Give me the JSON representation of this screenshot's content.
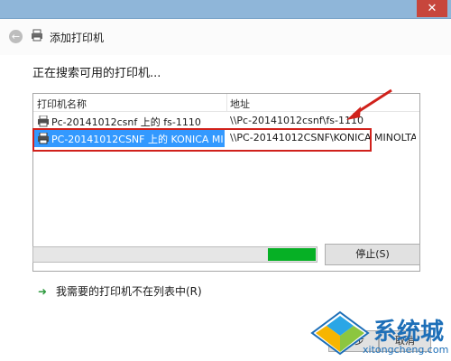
{
  "window": {
    "close_glyph": "✕"
  },
  "nav": {
    "back_glyph": "←",
    "title": "添加打印机",
    "printer_icon": "printer-icon"
  },
  "content": {
    "heading": "正在搜索可用的打印机...",
    "columns": [
      "打印机名称",
      "地址"
    ],
    "rows": [
      {
        "name": "Pc-20141012csnf 上的 fs-1110",
        "address": "\\\\Pc-20141012csnf\\fs-1110",
        "selected": false
      },
      {
        "name": "PC-20141012CSNF 上的 KONICA MINOL...",
        "address": "\\\\PC-20141012CSNF\\KONICA MINOLTA bi...",
        "selected": true
      }
    ],
    "progress_percent": 17,
    "stop_label": "停止(S)",
    "missing_printer_link": "我需要的打印机不在列表中(R)"
  },
  "footer": {
    "next_label": "下一步",
    "cancel_label": "取消"
  },
  "watermark": {
    "text": "系统城",
    "url": "xitongcheng.com"
  },
  "colors": {
    "accent": "#3399ff",
    "progress": "#06b025",
    "highlight_box": "#d0211b"
  }
}
